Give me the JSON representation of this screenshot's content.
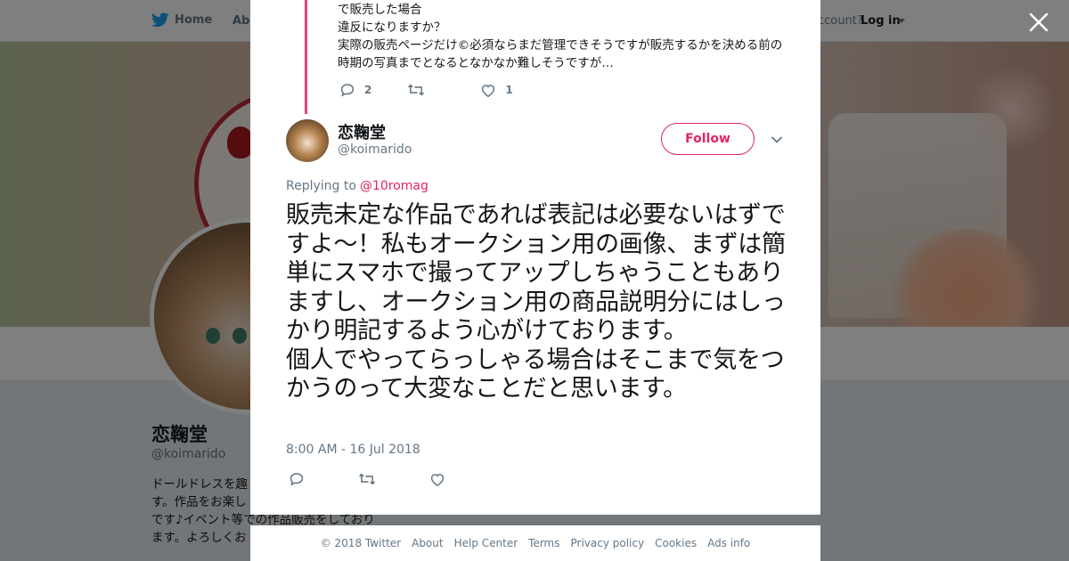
{
  "topnav": {
    "home_label": "Home",
    "about_label": "Abo",
    "account_text": "ccount?",
    "login_label": "Log in"
  },
  "profile": {
    "name": "恋鞠堂",
    "handle": "@koimarido",
    "bio": "ドールドレスを趣\nす。作品をお楽し\nです♪イベント等での作品販売をしており\nます。よろしくお"
  },
  "previous_tweet": {
    "text": "で販売した場合\n違反になりますか？\n実際の販売ページだけ©必須ならまだ管理できそうですが販売するかを決める前の時期の写真までとなるとなかなか難しそうですが…",
    "reply_count": "2",
    "like_count": "1"
  },
  "tweet": {
    "author_name": "恋鞠堂",
    "author_handle": "@koimarido",
    "follow_label": "Follow",
    "replying_label": "Replying to",
    "replying_to": "@10romag",
    "text": "販売未定な作品であれば表記は必要ないはずですよ〜！私もオークション用の画像、まずは簡単にスマホで撮ってアップしちゃうこともありますし、オークション用の商品説明分にはしっかり明記するよう心がけております。\n個人でやってらっしゃる場合はそこまで気をつかうのって大変なことだと思います。",
    "timestamp": "8:00 AM - 16 Jul 2018"
  },
  "footer": {
    "copyright": "© 2018 Twitter",
    "about": "About",
    "help": "Help Center",
    "terms": "Terms",
    "privacy": "Privacy policy",
    "cookies": "Cookies",
    "ads": "Ads info"
  },
  "colors": {
    "accent": "#e0245e",
    "twitter_blue": "#1da1f2",
    "muted": "#657786",
    "text": "#14171a"
  },
  "icons": [
    "twitter-bird-icon",
    "close-icon",
    "reply-icon",
    "retweet-icon",
    "like-icon",
    "chevron-down-icon"
  ]
}
